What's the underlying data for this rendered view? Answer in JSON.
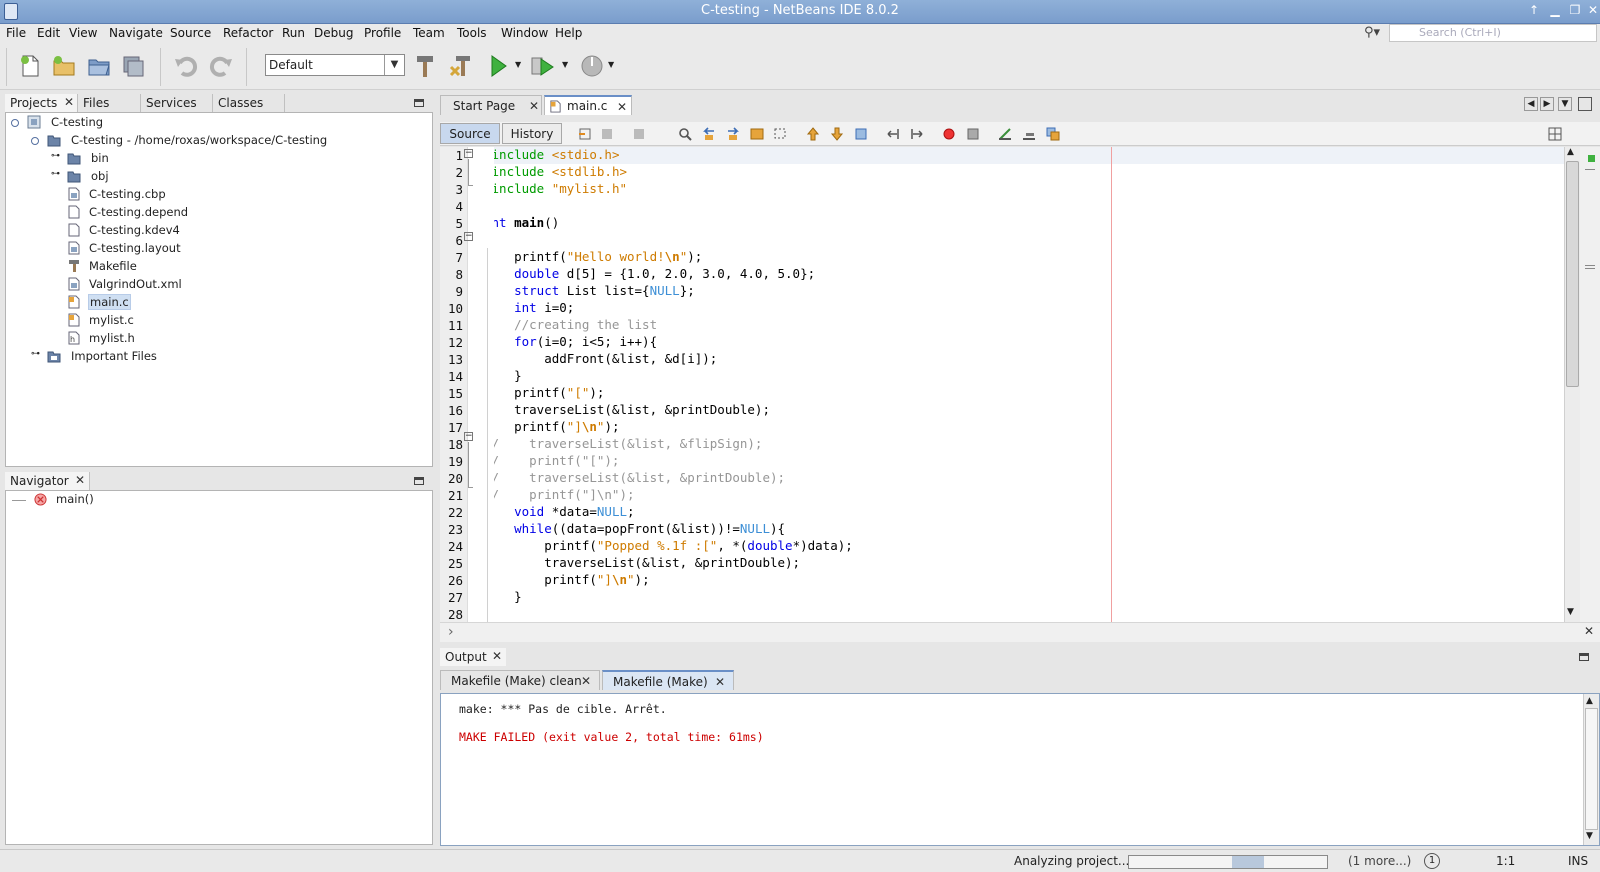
{
  "window": {
    "title": "C-testing - NetBeans IDE 8.0.2"
  },
  "menu": [
    "File",
    "Edit",
    "View",
    "Navigate",
    "Source",
    "Refactor",
    "Run",
    "Debug",
    "Profile",
    "Team",
    "Tools",
    "Window",
    "Help"
  ],
  "search": {
    "placeholder": "Search (Ctrl+I)"
  },
  "toolbar": {
    "config_value": "Default"
  },
  "projects_panel": {
    "tabs": [
      "Projects",
      "Files",
      "Services",
      "Classes"
    ],
    "tree": [
      {
        "label": "C-testing",
        "icon": "project-icon"
      },
      {
        "label": "C-testing - /home/roxas/workspace/C-testing",
        "icon": "folder-icon"
      },
      {
        "label": "bin",
        "icon": "folder-icon"
      },
      {
        "label": "obj",
        "icon": "folder-icon"
      },
      {
        "label": "C-testing.cbp",
        "icon": "xml-file-icon"
      },
      {
        "label": "C-testing.depend",
        "icon": "file-icon"
      },
      {
        "label": "C-testing.kdev4",
        "icon": "file-icon"
      },
      {
        "label": "C-testing.layout",
        "icon": "xml-file-icon"
      },
      {
        "label": "Makefile",
        "icon": "makefile-icon"
      },
      {
        "label": "ValgrindOut.xml",
        "icon": "xml-file-icon"
      },
      {
        "label": "main.c",
        "icon": "c-file-icon"
      },
      {
        "label": "mylist.c",
        "icon": "c-file-icon"
      },
      {
        "label": "mylist.h",
        "icon": "h-file-icon"
      },
      {
        "label": "Important Files",
        "icon": "important-files-icon"
      }
    ]
  },
  "navigator": {
    "title": "Navigator",
    "items": [
      "main()"
    ]
  },
  "editor": {
    "tabs": [
      "Start Page",
      "main.c"
    ],
    "modes": [
      "Source",
      "History"
    ],
    "line_numbers": [
      "1",
      "2",
      "3",
      "4",
      "5",
      "6",
      "7",
      "8",
      "9",
      "10",
      "11",
      "12",
      "13",
      "14",
      "15",
      "16",
      "17",
      "18",
      "19",
      "20",
      "21",
      "22",
      "23",
      "24",
      "25",
      "26",
      "27",
      "28"
    ],
    "lines": [
      "#include <stdio.h>",
      "#include <stdlib.h>",
      "#include \"mylist.h\"",
      "",
      "int main()",
      "{",
      "    printf(\"Hello world!\\n\");",
      "    double d[5] = {1.0, 2.0, 3.0, 4.0, 5.0};",
      "    struct List list={NULL};",
      "    int i=0;",
      "    //creating the list",
      "    for(i=0; i<5; i++){",
      "        addFront(&list, &d[i]);",
      "    }",
      "    printf(\"[\");",
      "    traverseList(&list, &printDouble);",
      "    printf(\"]\\n\");",
      "//    traverseList(&list, &flipSign);",
      "//    printf(\"[\");",
      "//    traverseList(&list, &printDouble);",
      "//    printf(\"]\\n\");",
      "    void *data=NULL;",
      "    while((data=popFront(&list))!=NULL){",
      "        printf(\"Popped %.1f :[\", *(double*)data);",
      "        traverseList(&list, &printDouble);",
      "        printf(\"]\\n\");",
      "    }",
      ""
    ]
  },
  "output": {
    "title": "Output",
    "tabs": [
      "Makefile (Make) clean",
      "Makefile (Make)"
    ],
    "lines": [
      "make: *** Pas de cible. Arrêt.",
      "",
      "MAKE FAILED (exit value 2, total time: 61ms)"
    ],
    "error_color": "#cc0000"
  },
  "status": {
    "analyzing": "Analyzing project...",
    "more": "(1 more...)",
    "notif": "1",
    "position": "1:1",
    "mode": "INS",
    "progress": 0.55
  },
  "colors": {
    "keyword": "#0000e6",
    "string": "#ce7b00",
    "comment": "#969696",
    "preprocessor": "#009b00",
    "null": "#3d8fd6",
    "title_bar": "#7a9dcc",
    "selection": "#cfdff2"
  }
}
